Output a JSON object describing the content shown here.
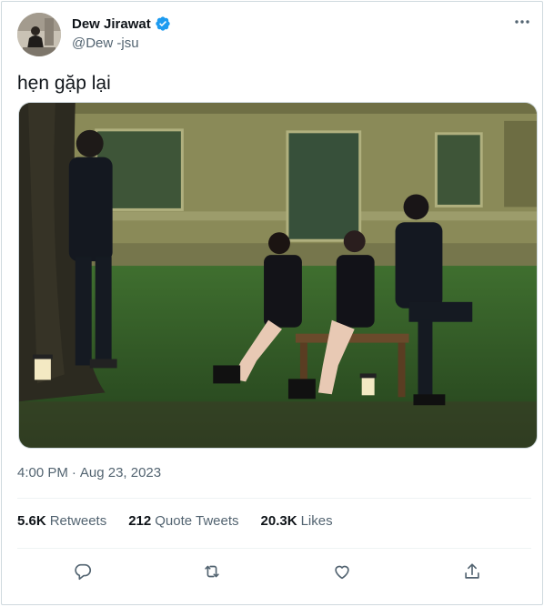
{
  "author": {
    "display_name": "Dew Jirawat",
    "handle": "@Dew -jsu",
    "verified": true
  },
  "tweet": {
    "text": "hẹn gặp lại"
  },
  "meta": {
    "time": "4:00 PM",
    "separator": "·",
    "date": "Aug 23, 2023"
  },
  "stats": [
    {
      "value": "5.6K",
      "label": "Retweets"
    },
    {
      "value": "212",
      "label": "Quote Tweets"
    },
    {
      "value": "20.3K",
      "label": "Likes"
    }
  ],
  "actions": [
    {
      "icon": "reply-icon"
    },
    {
      "icon": "retweet-icon"
    },
    {
      "icon": "like-icon"
    },
    {
      "icon": "share-icon"
    }
  ],
  "colors": {
    "verified_blue": "#1d9bf0",
    "secondary_text": "#536471",
    "primary_text": "#0f1419",
    "border": "#cfd9de"
  }
}
